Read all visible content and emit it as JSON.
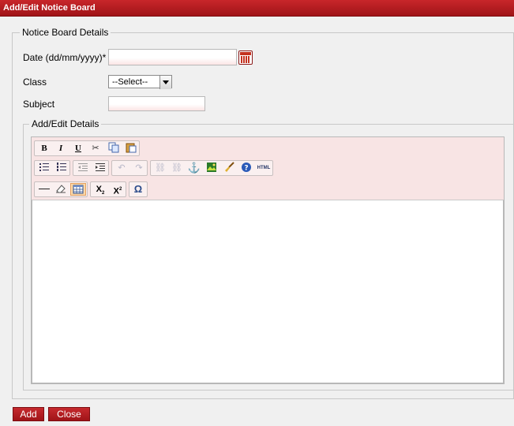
{
  "window": {
    "title": "Add/Edit Notice Board"
  },
  "form": {
    "legend": "Notice Board Details",
    "date_label": "Date (dd/mm/yyyy)*",
    "date_value": "",
    "class_label": "Class",
    "class_selected": "--Select--",
    "subject_label": "Subject",
    "subject_value": ""
  },
  "details": {
    "legend": "Add/Edit Details",
    "toolbar_rows": [
      [
        "bold",
        "italic",
        "underline",
        "cut",
        "copy",
        "paste"
      ],
      [
        "unordered-list",
        "ordered-list",
        "outdent",
        "indent",
        "undo",
        "redo",
        "link",
        "unlink",
        "anchor",
        "image",
        "cleanup",
        "help",
        "html"
      ],
      [
        "horizontal-rule",
        "remove-format",
        "table",
        "subscript",
        "superscript",
        "special-char"
      ]
    ],
    "labels": {
      "bold": "B",
      "italic": "I",
      "underline": "U",
      "html": "HTML",
      "omega": "Ω",
      "sub": "X",
      "sub_mark": "2",
      "sup": "X",
      "sup_mark": "2"
    }
  },
  "buttons": {
    "add": "Add",
    "close": "Close"
  },
  "colors": {
    "accent": "#b01c20",
    "toolbar_bg": "#f8e4e4",
    "active_tool": "#fcd8a8"
  }
}
